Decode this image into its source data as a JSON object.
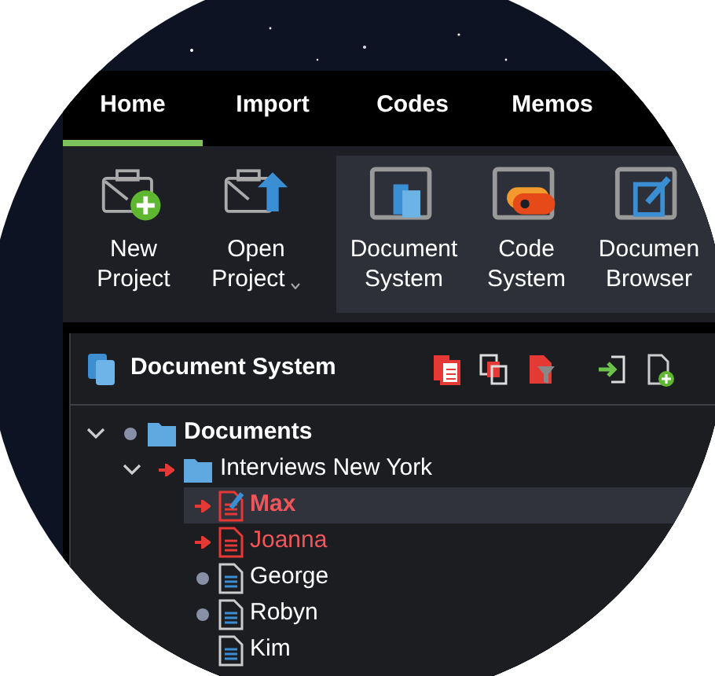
{
  "tabs": [
    {
      "label": "Home",
      "selected": true
    },
    {
      "label": "Import",
      "selected": false
    },
    {
      "label": "Codes",
      "selected": false
    },
    {
      "label": "Memos",
      "selected": false
    }
  ],
  "ribbon": {
    "groups": [
      {
        "highlighted": false,
        "buttons": [
          {
            "kind": "new_project",
            "label": [
              "New",
              "Project"
            ],
            "dropdown": false
          },
          {
            "kind": "open_project",
            "label": [
              "Open",
              "Project"
            ],
            "dropdown": true
          }
        ]
      },
      {
        "highlighted": true,
        "buttons": [
          {
            "kind": "document_system",
            "label": [
              "Document",
              "System"
            ],
            "dropdown": false
          },
          {
            "kind": "code_system",
            "label": [
              "Code",
              "System"
            ],
            "dropdown": false
          },
          {
            "kind": "document_browser",
            "label": [
              "Documen",
              "Browser"
            ],
            "dropdown": false
          }
        ]
      }
    ]
  },
  "panel": {
    "title": "Document System",
    "tree": [
      {
        "label": "Documents",
        "kind": "folder",
        "dot": true,
        "arrow": false,
        "expanded": true,
        "bold": true,
        "highlighted": false,
        "selected": false,
        "children": [
          {
            "label": "Interviews New York",
            "kind": "folder",
            "dot": false,
            "arrow": true,
            "expanded": true,
            "bold": false,
            "highlighted": false,
            "selected": false,
            "children": [
              {
                "label": "Max",
                "kind": "edited_document",
                "dot": false,
                "arrow": true,
                "bold": true,
                "highlighted": true,
                "selected": true
              },
              {
                "label": "Joanna",
                "kind": "document",
                "dot": false,
                "arrow": true,
                "bold": false,
                "highlighted": true,
                "selected": false
              },
              {
                "label": "George",
                "kind": "document",
                "dot": true,
                "arrow": false,
                "bold": false,
                "highlighted": false,
                "selected": false
              },
              {
                "label": "Robyn",
                "kind": "document",
                "dot": true,
                "arrow": false,
                "bold": false,
                "highlighted": false,
                "selected": false
              },
              {
                "label": "Kim",
                "kind": "document",
                "dot": false,
                "arrow": false,
                "bold": false,
                "highlighted": false,
                "selected": false
              }
            ]
          }
        ]
      }
    ]
  }
}
